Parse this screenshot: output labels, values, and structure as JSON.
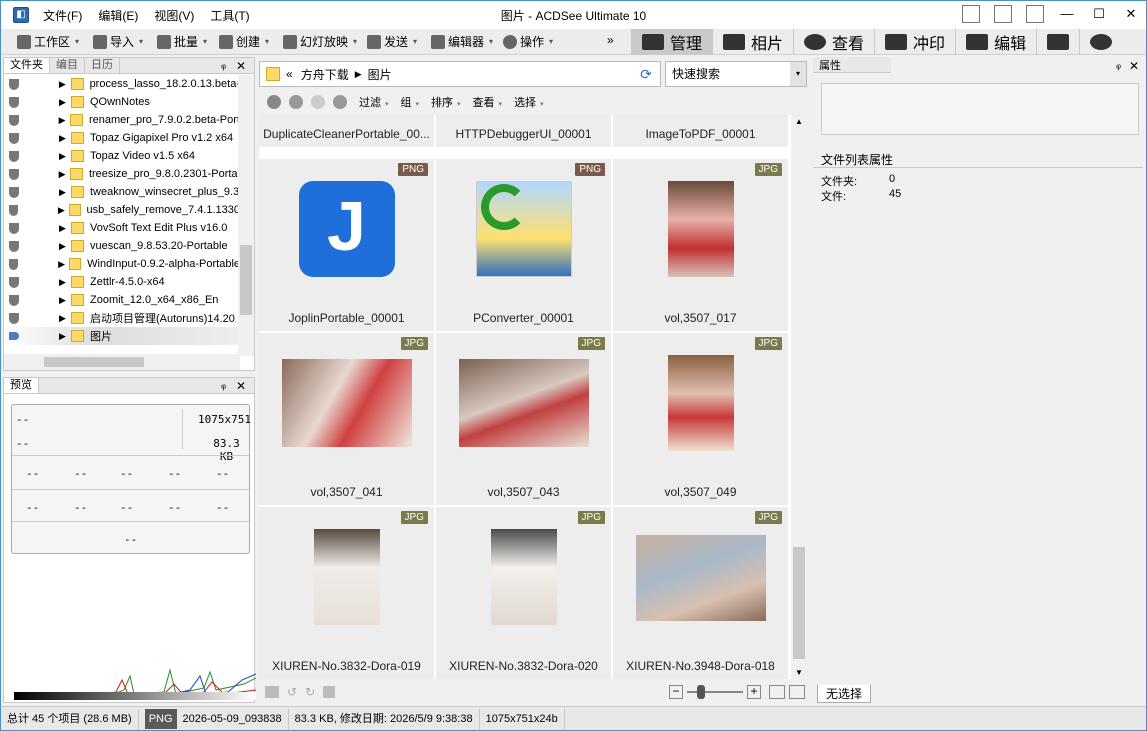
{
  "window": {
    "title": "图片 - ACDSee Ultimate 10"
  },
  "menu": [
    "文件(F)",
    "编辑(E)",
    "视图(V)",
    "工具(T)"
  ],
  "toolbar": {
    "items": [
      {
        "label": "工作区",
        "icon": "workspace-icon"
      },
      {
        "label": "导入",
        "icon": "import-icon"
      },
      {
        "label": "批量",
        "icon": "batch-icon"
      },
      {
        "label": "创建",
        "icon": "create-icon"
      },
      {
        "label": "幻灯放映",
        "icon": "slideshow-icon"
      },
      {
        "label": "发送",
        "icon": "send-icon"
      },
      {
        "label": "编辑器",
        "icon": "editor-icon"
      },
      {
        "label": "操作",
        "icon": "action-icon"
      }
    ],
    "overflow": "»"
  },
  "modes": [
    {
      "label": "管理",
      "icon": "grid-icon",
      "active": true
    },
    {
      "label": "相片",
      "icon": "photo-icon",
      "active": false
    },
    {
      "label": "查看",
      "icon": "eye-icon",
      "active": false
    },
    {
      "label": "冲印",
      "icon": "develop-icon",
      "active": false
    },
    {
      "label": "编辑",
      "icon": "edit-icon",
      "active": false
    },
    {
      "label": "",
      "icon": "dashboard-icon",
      "active": false
    },
    {
      "label": "",
      "icon": "365-icon",
      "active": false
    }
  ],
  "left_panel": {
    "tabs": [
      "文件夹",
      "编目",
      "日历"
    ],
    "tree": [
      "process_lasso_18.2.0.13.beta-",
      "QOwnNotes",
      "renamer_pro_7.9.0.2.beta-Port",
      "Topaz Gigapixel Pro v1.2 x64",
      "Topaz Video v1.5 x64",
      "treesize_pro_9.8.0.2301-Portal",
      "tweaknow_winsecret_plus_9.3",
      "usb_safely_remove_7.4.1.1330",
      "VovSoft Text Edit Plus v16.0",
      "vuescan_9.8.53.20-Portable",
      "WindInput-0.9.2-alpha-Portable",
      "Zettlr-4.5.0-x64",
      "Zoomit_12.0_x64_x86_En",
      "启动项目管理(Autoruns)14.20",
      "图片"
    ]
  },
  "preview": {
    "title": "预览",
    "dims": "1075x751",
    "size": "83.3 KB",
    "placeholder": "--"
  },
  "address": {
    "prefix": "«",
    "path": [
      "方舟下载",
      "图片"
    ]
  },
  "quick_search": {
    "placeholder": "快速搜索"
  },
  "nav": [
    "过滤",
    "组",
    "排序",
    "查看",
    "选择"
  ],
  "files": [
    {
      "name": "DuplicateCleanerPortable_00...",
      "badge": ""
    },
    {
      "name": "HTTPDebuggerUI_00001",
      "badge": ""
    },
    {
      "name": "ImageToPDF_00001",
      "badge": ""
    },
    {
      "name": "JoplinPortable_00001",
      "badge": "PNG"
    },
    {
      "name": "PConverter_00001",
      "badge": "PNG"
    },
    {
      "name": "vol,3507_017",
      "badge": "JPG"
    },
    {
      "name": "vol,3507_041",
      "badge": "JPG"
    },
    {
      "name": "vol,3507_043",
      "badge": "JPG"
    },
    {
      "name": "vol,3507_049",
      "badge": "JPG"
    },
    {
      "name": "XIUREN-No.3832-Dora-019",
      "badge": "JPG"
    },
    {
      "name": "XIUREN-No.3832-Dora-020",
      "badge": "JPG"
    },
    {
      "name": "XIUREN-No.3948-Dora-018",
      "badge": "JPG"
    }
  ],
  "right_panel": {
    "title": "属性",
    "section": "文件列表属性",
    "folders_label": "文件夹:",
    "folders_value": "0",
    "files_label": "文件:",
    "files_value": "45",
    "bottom_tab": "无选择"
  },
  "status": {
    "total": "总计 45 个项目 (28.6 MB)",
    "type": "PNG",
    "name": "2026-05-09_093838",
    "info": "83.3 KB, 修改日期: 2026/5/9 9:38:38",
    "res": "1075x751x24b"
  },
  "colors": {
    "png_badge": "#7a5a4a",
    "jpg_badge": "#7a7a4a",
    "accent": "#2d6bb3"
  }
}
